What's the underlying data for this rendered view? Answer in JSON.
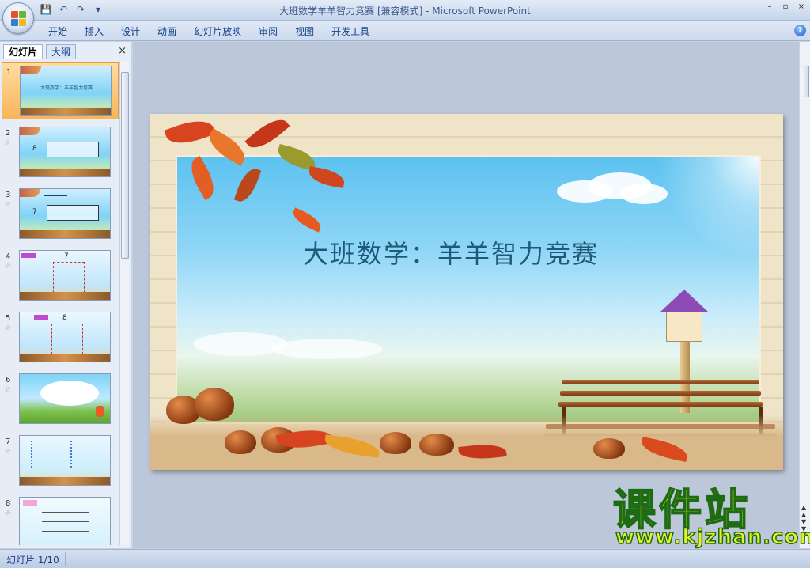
{
  "window": {
    "title": "大班数学羊羊智力竞赛 [兼容模式] - Microsoft PowerPoint"
  },
  "quick_access": {
    "save": "💾",
    "undo": "↶",
    "redo": "↷",
    "customize": "▾"
  },
  "window_controls": {
    "minimize": "–",
    "restore": "▫",
    "close": "×"
  },
  "ribbon": {
    "tabs": [
      "开始",
      "插入",
      "设计",
      "动画",
      "幻灯片放映",
      "审阅",
      "视图",
      "开发工具"
    ],
    "help": "?"
  },
  "slide_pane": {
    "tabs": [
      "幻灯片",
      "大纲"
    ],
    "close": "×",
    "slides": [
      {
        "number": "1",
        "selected": true,
        "star": ""
      },
      {
        "number": "2",
        "selected": false,
        "star": "☆"
      },
      {
        "number": "3",
        "selected": false,
        "star": "☆"
      },
      {
        "number": "4",
        "selected": false,
        "star": "☆"
      },
      {
        "number": "5",
        "selected": false,
        "star": "☆"
      },
      {
        "number": "6",
        "selected": false,
        "star": "☆"
      },
      {
        "number": "7",
        "selected": false,
        "star": "☆"
      },
      {
        "number": "8",
        "selected": false,
        "star": "☆"
      }
    ],
    "thumb_text": {
      "s1": "大班数学：羊羊智力竞赛",
      "s2": "8",
      "s3": "7",
      "s4": "7",
      "s5": "8"
    }
  },
  "slide": {
    "title": "大班数学：羊羊智力竞赛"
  },
  "watermark": {
    "name": "课件站",
    "url": "www.kjzhan.com"
  },
  "status": {
    "slide_indicator": "幻灯片 1/10"
  },
  "colors": {
    "ribbon_text": "#15428b",
    "selected_thumb": "#f8b55a",
    "slide_title": "#1e5a78",
    "watermark_fill": "#e7f02a",
    "watermark_stroke": "#1d6b12"
  }
}
